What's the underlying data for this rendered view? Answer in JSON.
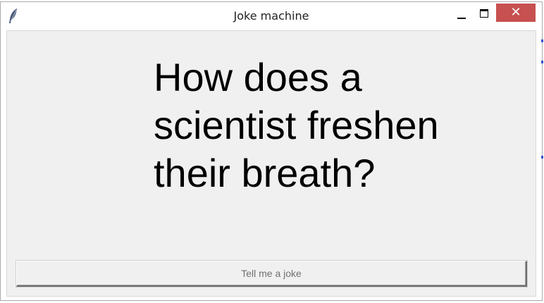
{
  "window": {
    "title": "Joke machine",
    "close_symbol": "✕"
  },
  "icons": {
    "app_icon": "feather-icon",
    "minimize": "minimize-icon",
    "maximize": "maximize-icon",
    "close": "close-icon"
  },
  "joke": {
    "text": "How does a scientist freshen their breath?"
  },
  "button": {
    "label": "Tell me a joke"
  },
  "colors": {
    "close_button": "#c75050",
    "client_background": "#f0f0f0",
    "button_text": "#707070"
  }
}
